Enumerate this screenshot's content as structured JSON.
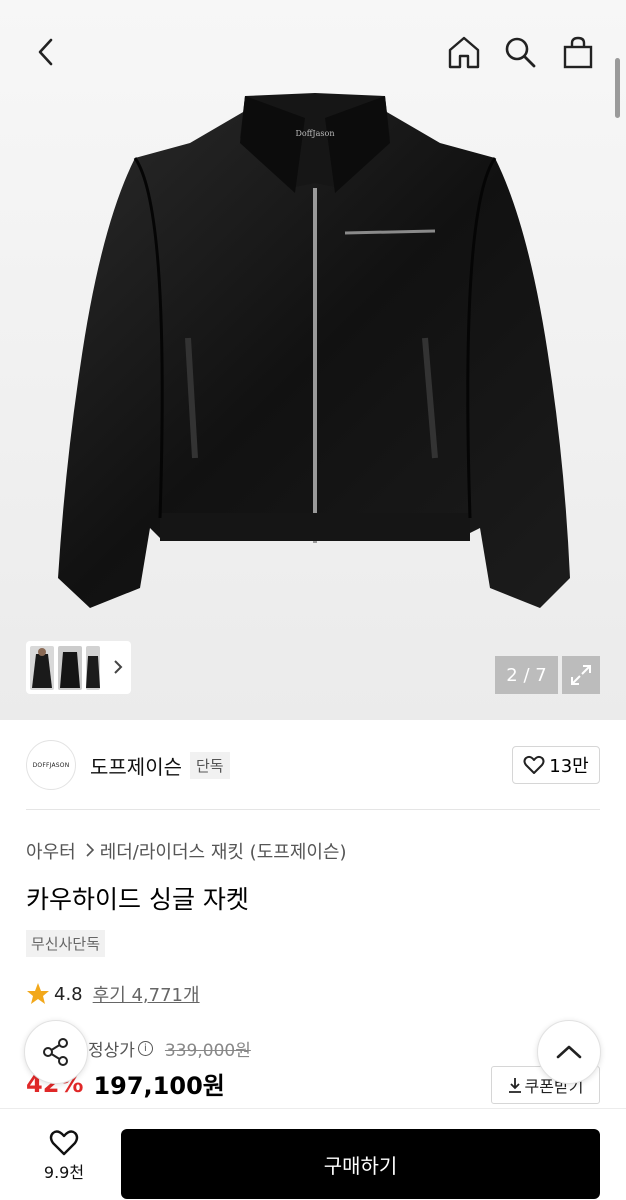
{
  "gallery": {
    "counter": "2 / 7",
    "jacket_label": "DoffJason"
  },
  "brand": {
    "logo_text": "DOFFJASON",
    "name": "도프제이슨",
    "badge": "단독",
    "likes": "13만"
  },
  "breadcrumb": {
    "category": "아우터",
    "subcategory": "레더/라이더스 재킷 (도프제이슨)"
  },
  "product": {
    "title": "카우하이드 싱글 자켓",
    "tag": "무신사단독"
  },
  "rating": {
    "score": "4.8",
    "reviews": "후기 4,771개"
  },
  "price": {
    "label": "정상가",
    "info": "i",
    "original": "339,000원",
    "discount": "42%",
    "final": "197,100원",
    "coupon_label": "쿠폰받기"
  },
  "bottom": {
    "wish_count": "9.9천",
    "buy_label": "구매하기"
  },
  "colors": {
    "discount": "#e02828",
    "star": "#f2a81b",
    "buy_button": "#000000"
  }
}
